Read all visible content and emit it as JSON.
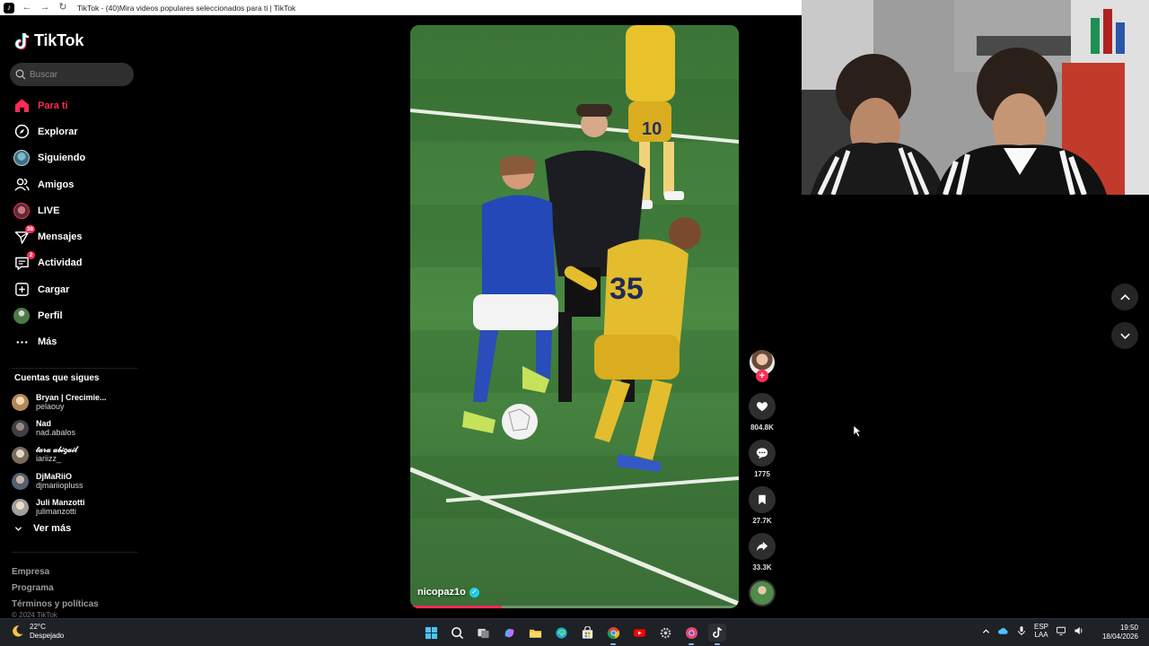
{
  "browser": {
    "tab_title": "TikTok - (40)Mira videos populares seleccionados para ti | TikTok"
  },
  "app": {
    "logo_text": "TikTok",
    "brand_color": "#fe2c55"
  },
  "search": {
    "placeholder": "Buscar"
  },
  "sidebar": {
    "items": [
      {
        "label": "Para ti",
        "icon": "home-icon",
        "active": true
      },
      {
        "label": "Explorar",
        "icon": "compass-icon"
      },
      {
        "label": "Siguiendo",
        "icon": "following-avatar-icon"
      },
      {
        "label": "Amigos",
        "icon": "friends-icon"
      },
      {
        "label": "LIVE",
        "icon": "live-icon"
      },
      {
        "label": "Mensajes",
        "icon": "messages-icon",
        "badge": "38"
      },
      {
        "label": "Actividad",
        "icon": "activity-icon",
        "badge": "2"
      },
      {
        "label": "Cargar",
        "icon": "upload-icon"
      },
      {
        "label": "Perfil",
        "icon": "profile-avatar-icon"
      },
      {
        "label": "Más",
        "icon": "more-icon"
      }
    ],
    "following_header": "Cuentas que sigues",
    "following": [
      {
        "name": "Bryan | Crecimie...",
        "handle": "pelaouy"
      },
      {
        "name": "Nad",
        "handle": "nad.abalos"
      },
      {
        "name": "𝓉𝒶𝓇𝒶 𝒶𝒷𝒾𝑔𝒶𝒾𝓁",
        "handle": "iariizz_"
      },
      {
        "name": "DjMaRiiO",
        "handle": "djmariiopluss"
      },
      {
        "name": "Juli Manzotti",
        "handle": "julimanzotti"
      }
    ],
    "see_more": "Ver más",
    "footer": [
      "Empresa",
      "Programa",
      "Términos y políticas"
    ],
    "copyright": "© 2024 TikTok"
  },
  "video": {
    "author": "nicopaz1o",
    "progress": 0.28,
    "likes": "804.8K",
    "comments": "1775",
    "saves": "27.7K",
    "shares": "33.3K"
  },
  "taskbar": {
    "temperature": "22°C",
    "condition": "Despejado",
    "lang_top": "ESP",
    "lang_bottom": "LAA",
    "time": "19:50",
    "date": "18/04/2026"
  }
}
